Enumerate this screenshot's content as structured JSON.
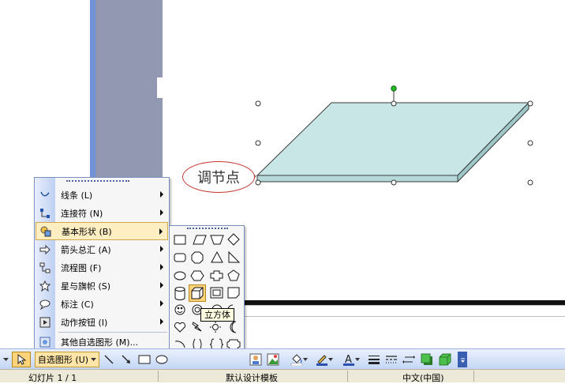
{
  "drawing_menu": {
    "items": [
      {
        "label": "线条 (L)",
        "icon": "line-icon",
        "submenu": true
      },
      {
        "label": "连接符 (N)",
        "icon": "connector-icon",
        "submenu": true
      },
      {
        "label": "基本形状 (B)",
        "icon": "basic-shapes-icon",
        "submenu": true,
        "selected": true
      },
      {
        "label": "箭头总汇 (A)",
        "icon": "block-arrows-icon",
        "submenu": true
      },
      {
        "label": "流程图 (F)",
        "icon": "flowchart-icon",
        "submenu": true
      },
      {
        "label": "星与旗帜 (S)",
        "icon": "stars-banners-icon",
        "submenu": true
      },
      {
        "label": "标注 (C)",
        "icon": "callouts-icon",
        "submenu": true
      },
      {
        "label": "动作按钮 (I)",
        "icon": "action-buttons-icon",
        "submenu": true
      },
      {
        "label": "其他自选图形 (M)...",
        "icon": "more-autoshapes-icon",
        "submenu": false
      }
    ]
  },
  "basic_shapes": {
    "tooltip": "立方体",
    "selected_shape": "cube"
  },
  "callout": {
    "text": "调节点"
  },
  "toolbar": {
    "autoshapes_label": "自选图形 (U)"
  },
  "status_bar": {
    "slide": "幻灯片 1 / 1",
    "template": "默认设计模板",
    "language": "中文(中国)"
  },
  "colors": {
    "shape_fill": "#c9e6e6",
    "shape_side": "#9ec8c8",
    "rotation_handle": "#22bb22",
    "adjust_handle": "#f5d000",
    "callout_border": "#c4362f"
  }
}
